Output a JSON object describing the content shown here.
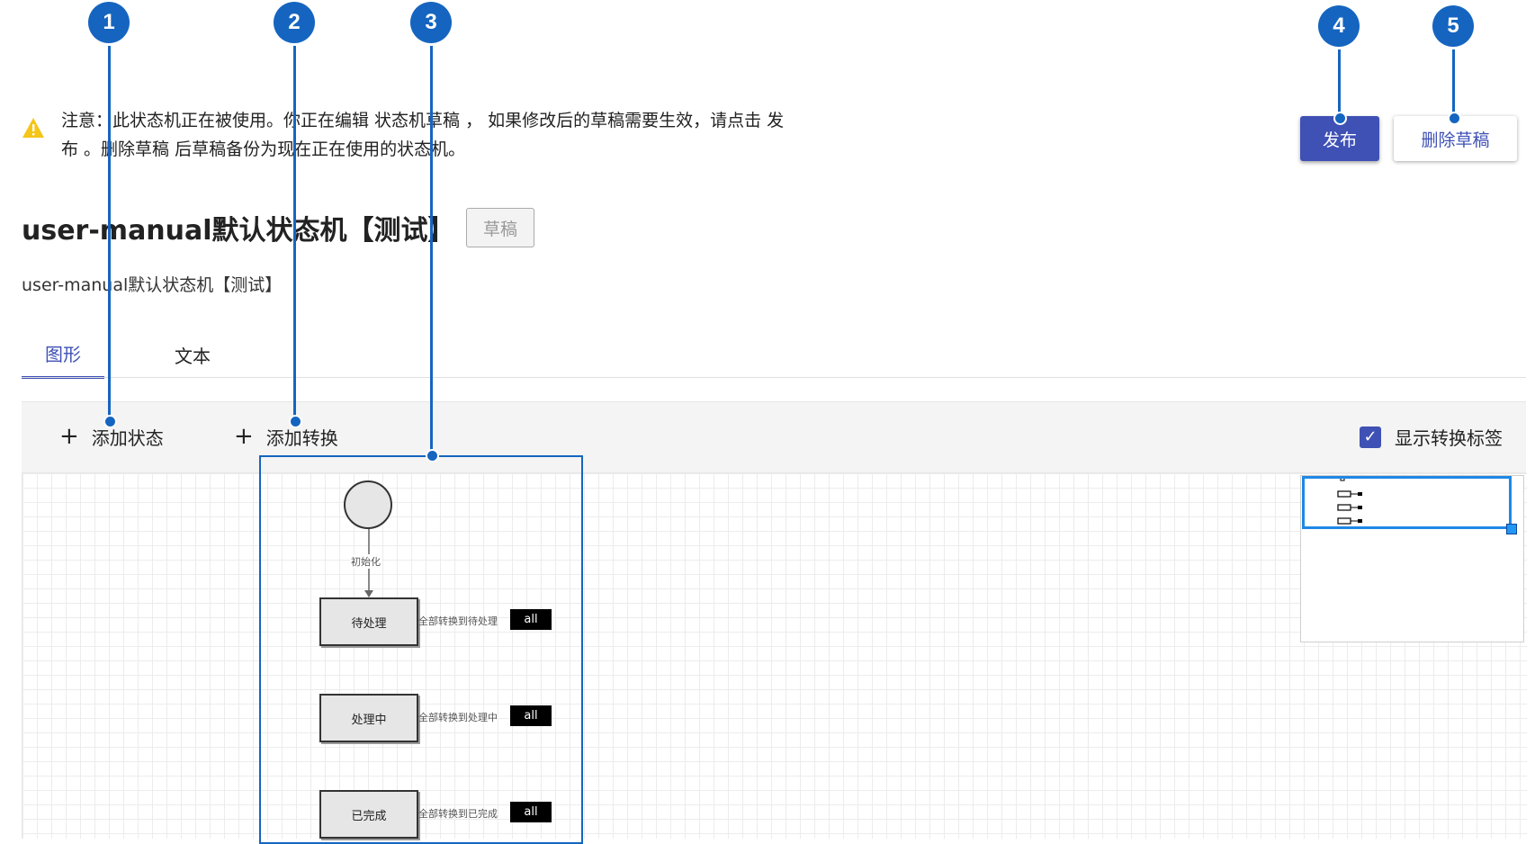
{
  "callouts": [
    "1",
    "2",
    "3",
    "4",
    "5"
  ],
  "notice": {
    "icon": "warning-icon",
    "text": "注意：此状态机正在被使用。你正在编辑 状态机草稿 ， 如果修改后的草稿需要生效，请点击 发布 。删除草稿 后草稿备份为现在正在使用的状态机。"
  },
  "header": {
    "publish_label": "发布",
    "delete_draft_label": "删除草稿"
  },
  "page": {
    "title": "user-manual默认状态机【测试】",
    "badge": "草稿",
    "description": "user-manual默认状态机【测试】"
  },
  "tabs": [
    {
      "label": "图形",
      "active": true
    },
    {
      "label": "文本",
      "active": false
    }
  ],
  "toolbar": {
    "add_state_label": "添加状态",
    "add_transition_label": "添加转换",
    "show_labels_text": "显示转换标签",
    "show_labels_checked": true
  },
  "diagram": {
    "init_edge_label": "初始化",
    "states": [
      {
        "name": "待处理",
        "edge_label": "全部转换到待处理",
        "tag": "all"
      },
      {
        "name": "处理中",
        "edge_label": "全部转换到处理中",
        "tag": "all"
      },
      {
        "name": "已完成",
        "edge_label": "全部转换到已完成",
        "tag": "all"
      }
    ]
  },
  "colors": {
    "primary": "#3f51b5",
    "callout": "#1565c0",
    "warning": "#f5c518"
  }
}
